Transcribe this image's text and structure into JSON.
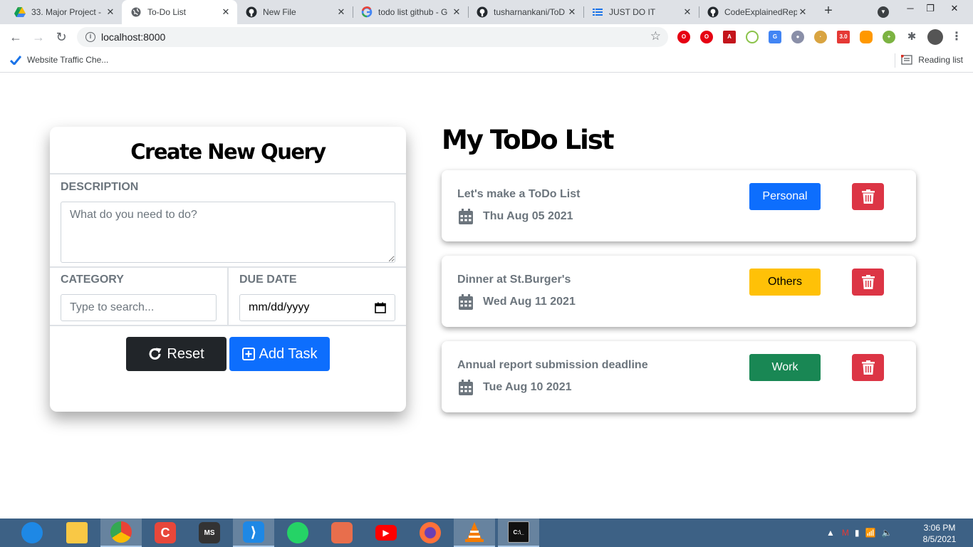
{
  "browser": {
    "tabs": [
      {
        "title": "33. Major Project -",
        "icon": "drive-icon",
        "active": false
      },
      {
        "title": "To-Do List",
        "icon": "globe-icon",
        "active": true
      },
      {
        "title": "New File",
        "icon": "github-icon",
        "active": false
      },
      {
        "title": "todo list github - G",
        "icon": "google-icon",
        "active": false
      },
      {
        "title": "tusharnankani/ToD",
        "icon": "github-icon",
        "active": false
      },
      {
        "title": "JUST DO IT",
        "icon": "list-icon",
        "active": false
      },
      {
        "title": "CodeExplainedRep",
        "icon": "github-icon",
        "active": false
      }
    ],
    "url": "localhost:8000",
    "bookmark": "Website Traffic Che...",
    "reading_list": "Reading list"
  },
  "form": {
    "title": "Create New Query",
    "description_label": "DESCRIPTION",
    "description_placeholder": "What do you need to do?",
    "category_label": "CATEGORY",
    "category_placeholder": "Type to search...",
    "due_date_label": "DUE DATE",
    "due_date_placeholder": "mm/dd/yyyy",
    "reset_label": "Reset",
    "add_label": "Add Task"
  },
  "list": {
    "title": "My ToDo List",
    "items": [
      {
        "description": "Let's make a ToDo List",
        "date": "Thu Aug 05 2021",
        "category": "Personal",
        "category_color": "#0d6efd",
        "category_text_color": "#ffffff"
      },
      {
        "description": "Dinner at St.Burger's",
        "date": "Wed Aug 11 2021",
        "category": "Others",
        "category_color": "#ffc107",
        "category_text_color": "#000000"
      },
      {
        "description": "Annual report submission deadline",
        "date": "Tue Aug 10 2021",
        "category": "Work",
        "category_color": "#198754",
        "category_text_color": "#ffffff"
      }
    ]
  },
  "taskbar": {
    "time": "3:06 PM",
    "date": "8/5/2021"
  }
}
